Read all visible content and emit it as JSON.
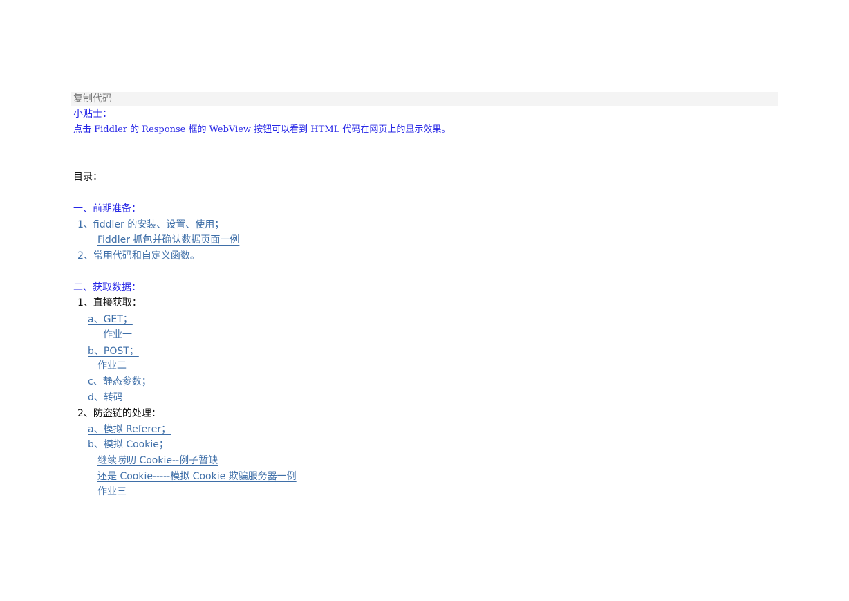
{
  "code_bar": {
    "label": "复制代码"
  },
  "tip": {
    "title": "小贴士：",
    "text": "点击 Fiddler 的 Response 框的 WebView 按钮可以看到 HTML 代码在网页上的显示效果。"
  },
  "toc": {
    "heading": "目录：",
    "section1": {
      "title": "一、前期准备：",
      "item1": "1、fiddler 的安装、设置、使用； ",
      "item1_sub": "Fiddler 抓包并确认数据页面一例",
      "item2": "2、常用代码和自定义函数。 "
    },
    "section2": {
      "title": "二、获取数据：",
      "direct": {
        "title": "1、直接获取：",
        "a": "a、GET； ",
        "a_hw": "作业一",
        "b": "b、POST； ",
        "b_hw": "作业二",
        "c": "c、静态参数； ",
        "d": "d、转码"
      },
      "antileech": {
        "title": "2、防盗链的处理：",
        "a": "a、模拟 Referer； ",
        "b": "b、模拟 Cookie； ",
        "b_sub1": "继续唠叨 Cookie--例子暂缺",
        "b_sub2": "还是 Cookie-----模拟 Cookie 欺骗服务器一例",
        "b_sub3": "作业三"
      }
    }
  }
}
